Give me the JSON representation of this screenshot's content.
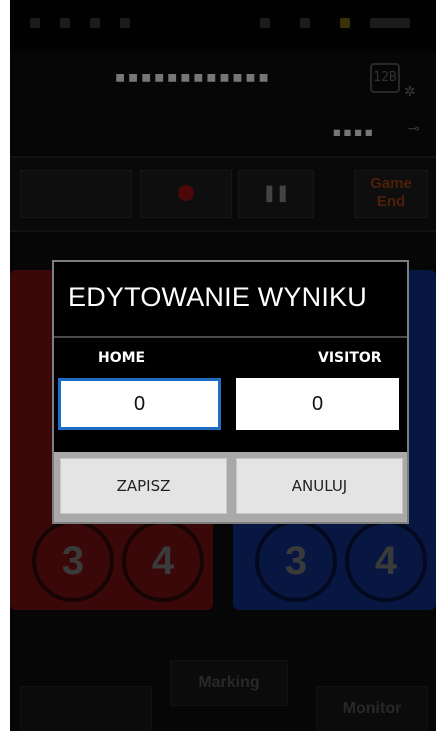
{
  "scoreboard": {
    "score_display": "▪▪▪▪▪▪▪▪▪▪▪▪",
    "time_display": "▪▪▪▪",
    "camera_icon_text": "12B"
  },
  "controls": {
    "game_end_line1": "Game",
    "game_end_line2": "End"
  },
  "teams": {
    "home_buttons": [
      "3",
      "4"
    ],
    "visitor_buttons": [
      "3",
      "4"
    ],
    "home_color": "#6a0f0f",
    "visitor_color": "#102a78"
  },
  "bottom_bar": {
    "marking_label": "Marking",
    "monitor_label": "Monitor"
  },
  "dialog": {
    "title": "EDYTOWANIE WYNIKU",
    "home_label": "HOME",
    "visitor_label": "VISITOR",
    "home_value": "0",
    "visitor_value": "0",
    "save_label": "ZAPISZ",
    "cancel_label": "ANULUJ",
    "accent_color": "#1e6fc4"
  }
}
